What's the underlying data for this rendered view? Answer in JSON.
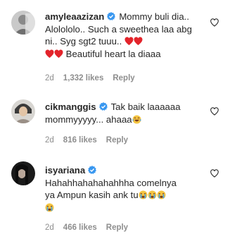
{
  "comments": [
    {
      "username": "amyleaazizan",
      "text_parts": [
        "Mommy buli dia.. Alolololo.. Such a sweethea",
        "laa abg ni.. Syg sgt2 tuuu..",
        "Beautiful heart la diaaa"
      ],
      "time": "2d",
      "likes": "1,332 likes",
      "reply": "Reply",
      "emojis_after_part2": [
        "red-heart",
        "red-heart"
      ],
      "emojis_before_part3": [
        "red-heart",
        "red-heart"
      ]
    },
    {
      "username": "cikmanggis",
      "text_parts": [
        "Tak baik laaaaaa",
        "mommyyyyy... ahaaa"
      ],
      "time": "2d",
      "likes": "816 likes",
      "reply": "Reply",
      "emojis_after_part2": [
        "face-with-tears-of-joy"
      ]
    },
    {
      "username": "isyariana",
      "text_parts": [
        "Hahahhahahahahhha comelnya",
        "ya Ampun kasih ank tu"
      ],
      "time": "2d",
      "likes": "466 likes",
      "reply": "Reply",
      "emojis_after_part2": [
        "loudly-crying-face",
        "loudly-crying-face",
        "loudly-crying-face",
        "loudly-crying-face"
      ]
    }
  ],
  "colors": {
    "text": "#262626",
    "meta": "#8e8e8e",
    "verified": "#3897f0",
    "heart": "#e0245e",
    "emoji_face": "#f4c542",
    "tears": "#4aa3df"
  }
}
